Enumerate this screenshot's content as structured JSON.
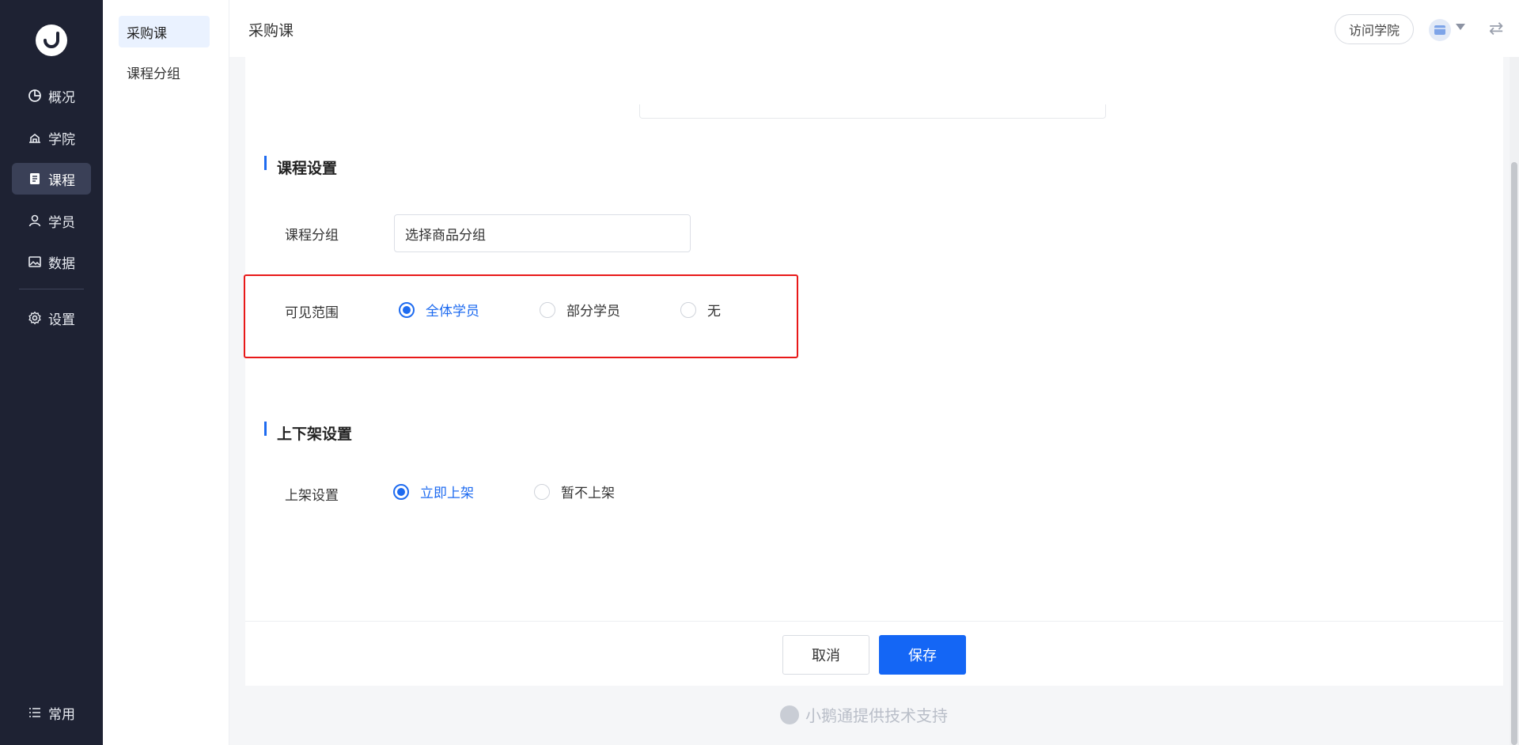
{
  "nav": {
    "items": [
      {
        "label": "概况",
        "icon": "pie-chart-icon"
      },
      {
        "label": "学院",
        "icon": "academy-icon"
      },
      {
        "label": "课程",
        "icon": "course-book-icon",
        "active": true
      },
      {
        "label": "学员",
        "icon": "user-icon"
      },
      {
        "label": "数据",
        "icon": "image-data-icon"
      },
      {
        "label": "设置",
        "icon": "gear-icon"
      }
    ],
    "bottom": {
      "label": "常用",
      "icon": "list-icon"
    }
  },
  "subnav": {
    "items": [
      {
        "label": "采购课",
        "active": true
      },
      {
        "label": "课程分组"
      }
    ]
  },
  "header": {
    "title": "采购课",
    "visit_button": "访问学院"
  },
  "form": {
    "course_settings": {
      "title": "课程设置",
      "group_label": "课程分组",
      "group_value": "选择商品分组",
      "visibility_label": "可见范围",
      "visibility_options": [
        "全体学员",
        "部分学员",
        "无"
      ],
      "visibility_selected": "全体学员"
    },
    "listing_settings": {
      "title": "上下架设置",
      "listing_label": "上架设置",
      "listing_options": [
        "立即上架",
        "暂不上架"
      ],
      "listing_selected": "立即上架"
    }
  },
  "footer": {
    "cancel_label": "取消",
    "save_label": "保存",
    "powered_by": "小鹅通提供技术支持"
  },
  "colors": {
    "accent": "#1e6bf0",
    "nav_bg": "#1e2233",
    "highlight": "#e81919"
  }
}
